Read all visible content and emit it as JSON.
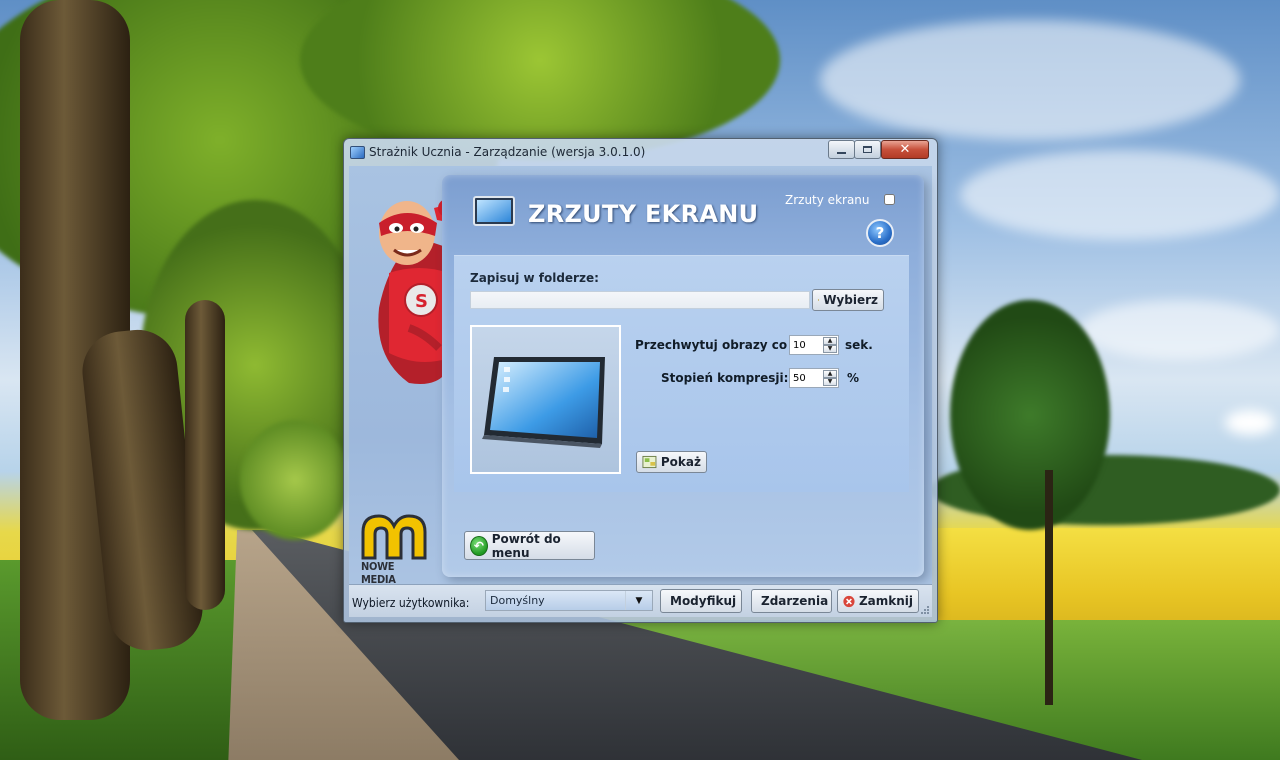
{
  "window": {
    "title": "Strażnik Ucznia - Zarządzanie (wersja 3.0.1.0)",
    "close_symbol": "✕"
  },
  "logo": {
    "text": "NOWE MEDIA"
  },
  "panel": {
    "title": "ZRZUTY EKRANU",
    "enable_label": "Zrzuty ekranu",
    "enable_checked": false,
    "help_symbol": "?"
  },
  "folder": {
    "label": "Zapisuj w folderze:",
    "value": "",
    "browse_label": "Wybierz"
  },
  "capture": {
    "interval_label": "Przechwytuj obrazy co",
    "interval_value": "10",
    "interval_unit": "sek.",
    "compression_label": "Stopień kompresji:",
    "compression_value": "50",
    "compression_unit": "%",
    "show_label": "Pokaż"
  },
  "navigation": {
    "back_label": "Powrót do menu"
  },
  "bottombar": {
    "user_label": "Wybierz użytkownika:",
    "user_selected": "Domyślny",
    "modify_label": "Modyfikuj",
    "events_label": "Zdarzenia",
    "close_label": "Zamknij"
  },
  "colors": {
    "panel_blue": "#8eaedb",
    "title_text": "#ffffff",
    "close_red": "#c7503b"
  }
}
